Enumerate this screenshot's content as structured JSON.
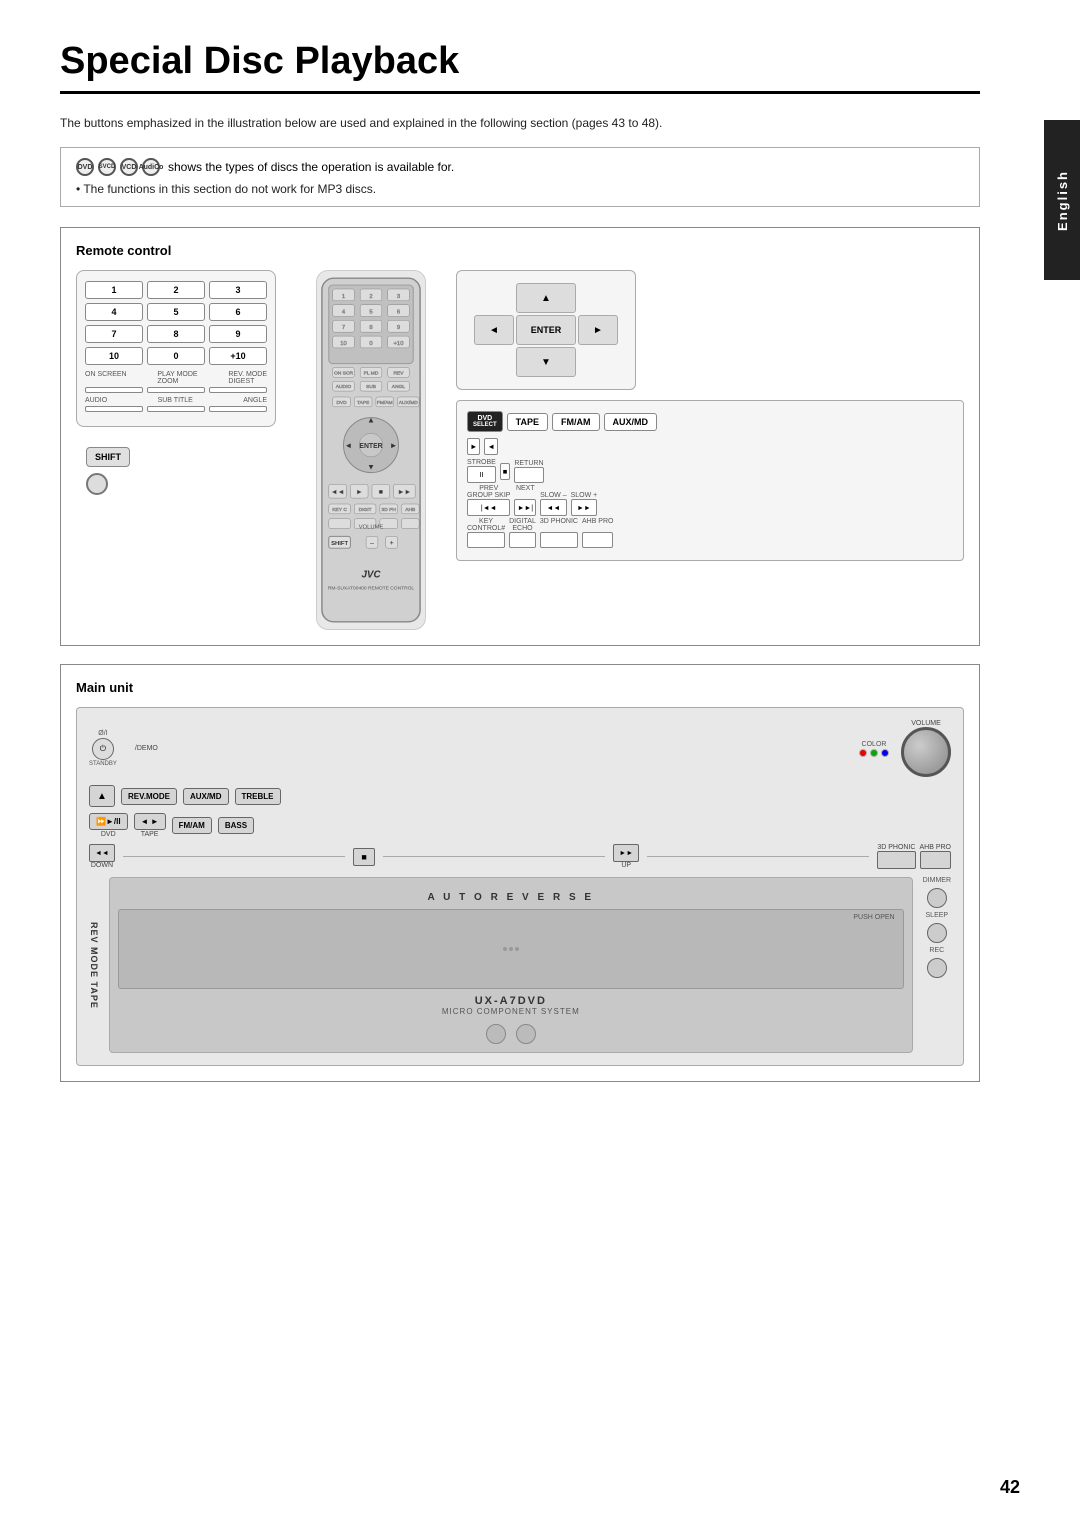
{
  "page": {
    "title": "Special Disc Playback",
    "page_number": "42",
    "side_tab": "English"
  },
  "description": "The buttons emphasized in the illustration below are used and explained in the following section (pages 43 to 48).",
  "info_box": {
    "disc_types": [
      "DVD",
      "SVCD",
      "VCD",
      "Audio CD"
    ],
    "shows_text": "shows the types of discs the operation is available for.",
    "bullet": "The functions in this section do not work for MP3 discs."
  },
  "sections": {
    "remote_control": {
      "label": "Remote control"
    },
    "main_unit": {
      "label": "Main unit"
    }
  },
  "remote": {
    "num_buttons": [
      "1",
      "2",
      "3",
      "4",
      "5",
      "6",
      "7",
      "8",
      "9",
      "10",
      "0",
      "+10"
    ],
    "mode_labels": [
      "ON SCREEN",
      "PLAY MODE ZOOM",
      "REV. MODE DIGEST"
    ],
    "bottom_labels": [
      "AUDIO",
      "SUB TITLE",
      "ANGLE"
    ],
    "shift_label": "SHIFT",
    "jvc_label": "JVC"
  },
  "right_panel": {
    "source_buttons": [
      "DVD SELECT",
      "TAPE",
      "FM/AM",
      "AUX/MD"
    ],
    "play_label": "►",
    "tape_rev_label": "◄",
    "strobe_label": "STROBE",
    "ii_label": "II",
    "stop_label": "■",
    "return_label": "RETURN",
    "prev_label": "PREV",
    "next_label": "NEXT",
    "group_skip_label": "GROUP SKIP",
    "rew_label": "◄◄",
    "ff_label": "►►",
    "slow_minus": "SLOW –",
    "slow_plus": "SLOW +",
    "slow_rew": "◄◄",
    "key_control": "KEY CONTROL#",
    "digital_echo": "DIGITAL ECHO",
    "phonic_3d": "3D PHONIC",
    "ahb_pro": "AHB PRO"
  },
  "main_unit": {
    "power_label": "Ø/I",
    "standby_label": "STANDBY",
    "demo_label": "/DEMO",
    "color_label": "COLOR",
    "volume_label": "VOLUME",
    "eject_label": "▲",
    "rev_mode_label": "REV.MODE",
    "aux_md_label": "AUX/MD",
    "treble_label": "TREBLE",
    "dvd_label": "DVD",
    "tape_label": "◄ ►\nTAPE",
    "fm_am_label": "FM/AM",
    "bass_label": "BASS",
    "down_label": "DOWN",
    "up_label": "UP",
    "phonic_3d_label": "3D PHONIC",
    "ahb_pro_label": "AHB PRO",
    "auto_reverse": "A U T O   R E V E R S E",
    "push_open": "PUSH OPEN",
    "model_name": "UX-A7DVD",
    "model_sub": "MICRO COMPONENT SYSTEM",
    "dimmer": "DIMMER",
    "sleep": "SLEEP",
    "rec": "REC"
  }
}
